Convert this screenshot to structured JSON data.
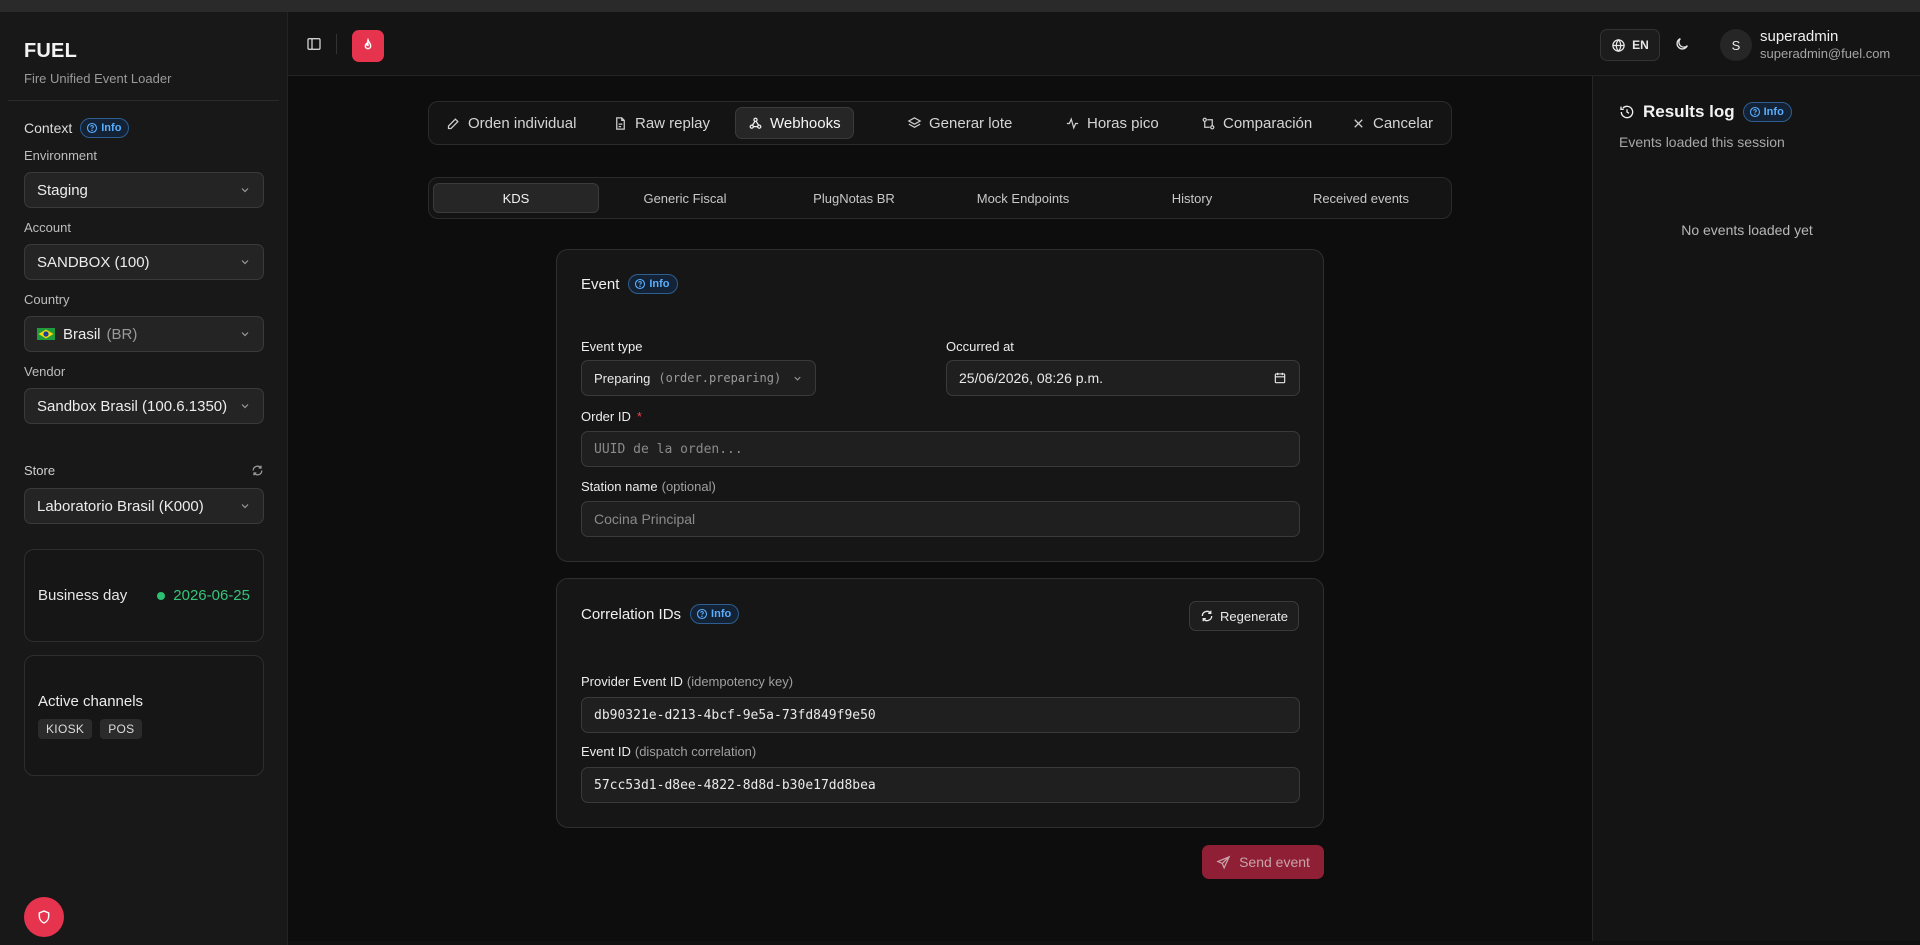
{
  "app": {
    "name": "FUEL",
    "subtitle": "Fire Unified Event Loader"
  },
  "sidebar": {
    "context_label": "Context",
    "info_label": "Info",
    "environment": {
      "label": "Environment",
      "value": "Staging"
    },
    "account": {
      "label": "Account",
      "value": "SANDBOX (100)"
    },
    "country": {
      "label": "Country",
      "value": "Brasil",
      "code": "(BR)"
    },
    "vendor": {
      "label": "Vendor",
      "value": "Sandbox Brasil (100.6.1350)"
    },
    "store": {
      "label": "Store",
      "value": "Laboratorio Brasil (K000)"
    },
    "business_day": {
      "label": "Business day",
      "value": "2026-06-25"
    },
    "channels": {
      "label": "Active channels",
      "items": [
        "KIOSK",
        "POS"
      ]
    }
  },
  "header": {
    "lang": "EN",
    "user": {
      "initial": "S",
      "name": "superadmin",
      "email": "superadmin@fuel.com"
    }
  },
  "main_tabs": [
    {
      "label": "Orden individual",
      "icon": "pencil-icon"
    },
    {
      "label": "Raw replay",
      "icon": "file-icon"
    },
    {
      "label": "Webhooks",
      "icon": "webhook-icon",
      "active": true
    },
    {
      "label": "Generar lote",
      "icon": "layers-icon"
    },
    {
      "label": "Horas pico",
      "icon": "activity-icon"
    },
    {
      "label": "Comparación",
      "icon": "compare-icon"
    },
    {
      "label": "Cancelar",
      "icon": "x-icon"
    }
  ],
  "sub_tabs": [
    {
      "label": "KDS",
      "active": true
    },
    {
      "label": "Generic Fiscal"
    },
    {
      "label": "PlugNotas BR"
    },
    {
      "label": "Mock Endpoints"
    },
    {
      "label": "History"
    },
    {
      "label": "Received events"
    }
  ],
  "event": {
    "title": "Event",
    "info_label": "Info",
    "event_type": {
      "label": "Event type",
      "value": "Preparing",
      "code": "(order.preparing)"
    },
    "occurred_at": {
      "label": "Occurred at",
      "value": "25/06/2026, 08:26 p.m."
    },
    "order_id": {
      "label": "Order ID",
      "required_mark": "*",
      "placeholder": "UUID de la orden..."
    },
    "station": {
      "label": "Station name",
      "hint": "(optional)",
      "placeholder": "Cocina Principal"
    }
  },
  "correlation": {
    "title": "Correlation IDs",
    "info_label": "Info",
    "regenerate_label": "Regenerate",
    "provider_event_id": {
      "label": "Provider Event ID",
      "hint": "(idempotency key)",
      "value": "db90321e-d213-4bcf-9e5a-73fd849f9e50"
    },
    "event_id": {
      "label": "Event ID",
      "hint": "(dispatch correlation)",
      "value": "57cc53d1-d8ee-4822-8d8d-b30e17dd8bea"
    }
  },
  "send_label": "Send event",
  "results": {
    "title": "Results log",
    "info_label": "Info",
    "subtitle": "Events loaded this session",
    "empty": "No events loaded yet"
  },
  "colors": {
    "accent": "#e7344e",
    "info": "#5aaeff",
    "success": "#2cc073"
  }
}
